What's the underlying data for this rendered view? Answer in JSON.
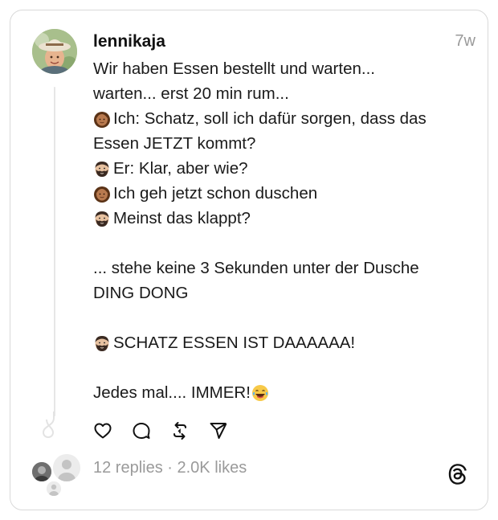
{
  "post": {
    "username": "lennikaja",
    "timestamp": "7w",
    "lines": [
      {
        "emoji": "",
        "text": "Wir haben Essen bestellt und warten..."
      },
      {
        "emoji": "",
        "text": "warten... erst 20 min rum..."
      },
      {
        "emoji": "woman",
        "text": "Ich: Schatz, soll ich dafür sorgen, dass das"
      },
      {
        "emoji": "",
        "text": "Essen JETZT kommt?"
      },
      {
        "emoji": "man",
        "text": "Er: Klar, aber wie?"
      },
      {
        "emoji": "woman",
        "text": "Ich geh jetzt schon duschen"
      },
      {
        "emoji": "man",
        "text": "Meinst das klappt?"
      },
      {
        "emoji": "",
        "text": ""
      },
      {
        "emoji": "",
        "text": "... stehe keine 3 Sekunden unter der Dusche"
      },
      {
        "emoji": "",
        "text": "DING DONG"
      },
      {
        "emoji": "",
        "text": ""
      },
      {
        "emoji": "man",
        "text": "SCHATZ ESSEN IST DAAAAAA!"
      },
      {
        "emoji": "",
        "text": ""
      },
      {
        "emoji": "",
        "text": "Jedes mal.... IMMER!"
      }
    ],
    "trailing_emoji": "laughing-tears"
  },
  "actions": {
    "icons": [
      "heart-icon",
      "comment-icon",
      "repost-icon",
      "share-icon"
    ]
  },
  "stats": {
    "replies": "12 replies",
    "separator": " · ",
    "likes": "2.0K likes"
  },
  "brand": {
    "logo": "threads-logo-icon"
  }
}
